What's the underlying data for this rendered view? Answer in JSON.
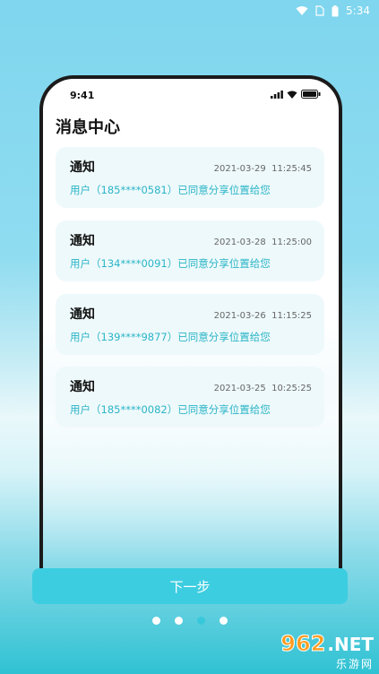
{
  "status_bar": {
    "time": "5:34"
  },
  "phone": {
    "status_time": "9:41",
    "title": "消息中心"
  },
  "notifications": [
    {
      "title": "通知",
      "time": "2021-03-29  11:25:45",
      "message": "用户（185****0581）已同意分享位置给您"
    },
    {
      "title": "通知",
      "time": "2021-03-28  11:25:00",
      "message": "用户（134****0091）已同意分享位置给您"
    },
    {
      "title": "通知",
      "time": "2021-03-26  11:15:25",
      "message": "用户（139****9877）已同意分享位置给您"
    },
    {
      "title": "通知",
      "time": "2021-03-25  10:25:25",
      "message": "用户（185****0082）已同意分享位置给您"
    }
  ],
  "next_button_label": "下一步",
  "pager": {
    "count": 4,
    "active_index": 2
  },
  "watermark": {
    "main": "962",
    "net": ".NET",
    "sub": "乐游网"
  },
  "colors": {
    "accent": "#3ccde0",
    "message_text": "#2bb5c7",
    "card_bg": "#eef9fb"
  }
}
